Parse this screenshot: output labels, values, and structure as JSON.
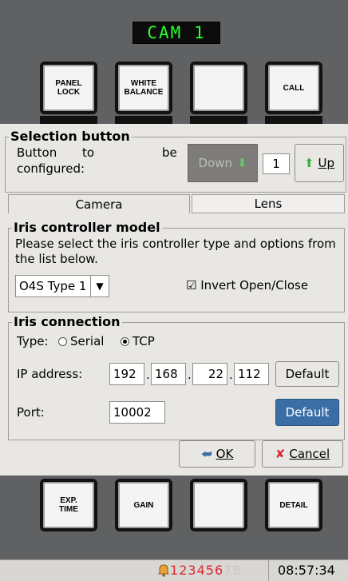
{
  "camera_panel": {
    "display": "CAM  1",
    "top_buttons": [
      "PANEL\nLOCK",
      "WHITE\nBALANCE",
      "",
      "CALL"
    ],
    "bottom_buttons": [
      "EXP.\nTIME",
      "GAIN",
      "",
      "DETAIL"
    ]
  },
  "dialog": {
    "selection": {
      "title": "Selection button",
      "label_line1_a": "Button",
      "label_line1_b": "to",
      "label_line1_c": "be",
      "label_line2": "configured:",
      "down_label": "Down",
      "value": "1",
      "up_label": "Up"
    },
    "tabs": [
      "Camera",
      "Lens"
    ],
    "iris_model": {
      "title": "Iris controller model",
      "description": "Please select the iris controller type and options from the list below.",
      "type_value": "O4S Type 1",
      "invert_label": "Invert Open/Close",
      "invert_checked": true
    },
    "iris_connection": {
      "title": "Iris connection",
      "type_label": "Type:",
      "serial_label": "Serial",
      "tcp_label": "TCP",
      "selected": "TCP",
      "ip_label": "IP address:",
      "ip_octets": [
        "192",
        "168",
        "22",
        "112"
      ],
      "ip_default_label": "Default",
      "port_label": "Port:",
      "port_value": "10002",
      "port_default_label": "Default"
    },
    "ok_label": "OK",
    "cancel_label": "Cancel"
  },
  "status": {
    "numbers": [
      "1",
      "2",
      "3",
      "4",
      "5",
      "6",
      "7",
      "8"
    ],
    "active_color": "#d8262e",
    "time": "08:57:34"
  },
  "colors": {
    "accent_blue": "#3a6ea5",
    "down_gray": "#7d7c7a",
    "arrow_green": "#3db33d"
  }
}
